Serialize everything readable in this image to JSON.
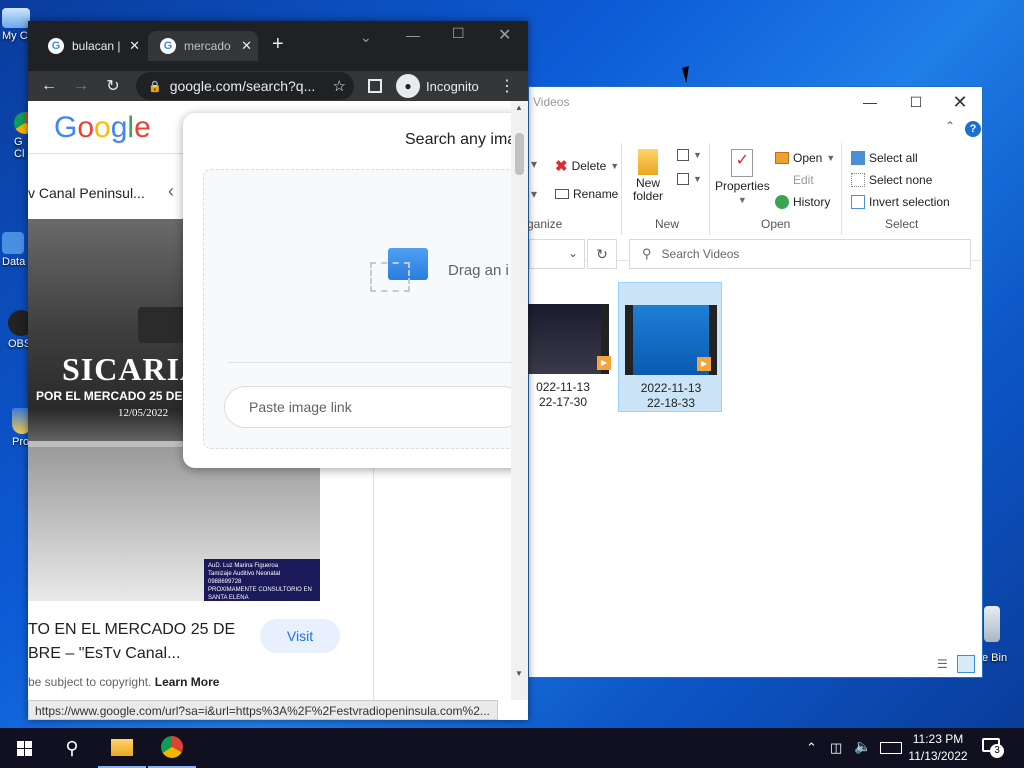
{
  "desktop": {
    "icons": [
      {
        "label": "My C",
        "glyph": "computer-icon"
      },
      {
        "label": "G\nCl",
        "glyph": "chrome-icon"
      },
      {
        "label": "Data",
        "glyph": "data-icon"
      },
      {
        "label": "OBS",
        "glyph": "obs-icon"
      },
      {
        "label": "Pro",
        "glyph": "shield-icon"
      }
    ],
    "recycle_label": "e Bin"
  },
  "chrome": {
    "tabs": [
      {
        "label": "bulacan |",
        "active": false
      },
      {
        "label": "mercado",
        "active": true
      }
    ],
    "url": "google.com/search?q...",
    "incognito_label": "Incognito",
    "status_url": "https://www.google.com/url?sa=i&url=https%3A%2F%2Festvradiopeninsula.com%2...",
    "page": {
      "logo": "Google",
      "result_title": "v Canal Peninsul...",
      "image_heading": "SICARIA",
      "image_subheading": "POR EL MERCADO 25 DE S",
      "image_date": "12/05/2022",
      "caption_line1": "TO EN EL MERCADO 25 DE",
      "caption_line2": "BRE – \"EsTv Canal...",
      "visit_label": "Visit",
      "copyright_text": "be subject to copyright.",
      "learn_more": "Learn More",
      "ad_line1": "AuD. Luz Marina Figueroa",
      "ad_line2": "Tamizaje Auditivo Neonatal",
      "ad_line3": "0988699728",
      "ad_line4": "PROXIMAMENTE CONSULTORIO EN SANTA ELENA"
    },
    "lens": {
      "title": "Search any ima",
      "drag_text": "Drag an i",
      "paste_placeholder": "Paste image link"
    }
  },
  "explorer": {
    "title": "Videos",
    "ribbon": {
      "delete": "Delete",
      "rename": "Rename",
      "organize": "rganize",
      "new_folder": "New\nfolder",
      "new_group": "New",
      "properties": "Properties",
      "open": "Open",
      "edit": "Edit",
      "history": "History",
      "open_group": "Open",
      "select_all": "Select all",
      "select_none": "Select none",
      "invert_selection": "Invert selection",
      "select_group": "Select"
    },
    "search_placeholder": "Search Videos",
    "files": [
      {
        "line1": "022-11-13",
        "line2": "22-17-30",
        "selected": false
      },
      {
        "line1": "2022-11-13",
        "line2": "22-18-33",
        "selected": true
      }
    ]
  },
  "taskbar": {
    "time": "11:23 PM",
    "date": "11/13/2022",
    "notification_count": "3"
  }
}
